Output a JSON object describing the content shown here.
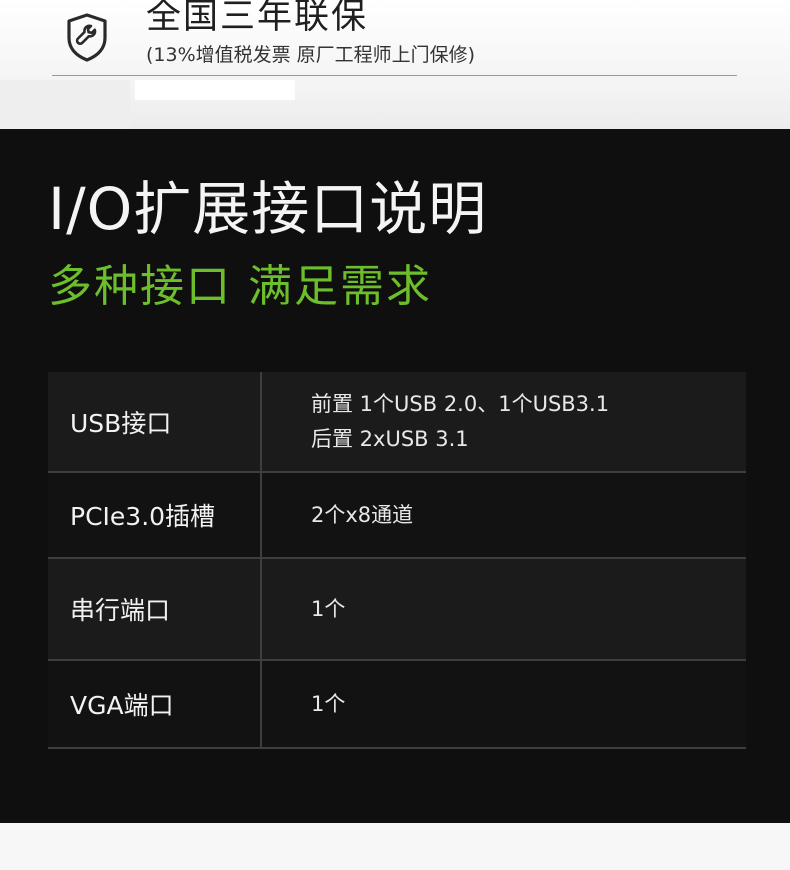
{
  "warranty": {
    "icon": "shield-wrench-icon",
    "title": "全国三年联保",
    "subtitle": "(13%增值税发票 原厂工程师上门保修)"
  },
  "io_section": {
    "title": "I/O扩展接口说明",
    "subtitle": "多种接口 满足需求",
    "accent_color": "#6cbf2a",
    "rows": [
      {
        "key": "USB接口",
        "values": [
          "前置  1个USB 2.0、1个USB3.1",
          "后置  2xUSB 3.1"
        ]
      },
      {
        "key": "PCIe3.0插槽",
        "values": [
          "2个x8通道"
        ]
      },
      {
        "key": "串行端口",
        "values": [
          "1个"
        ]
      },
      {
        "key": "VGA端口",
        "values": [
          "1个"
        ]
      }
    ]
  }
}
